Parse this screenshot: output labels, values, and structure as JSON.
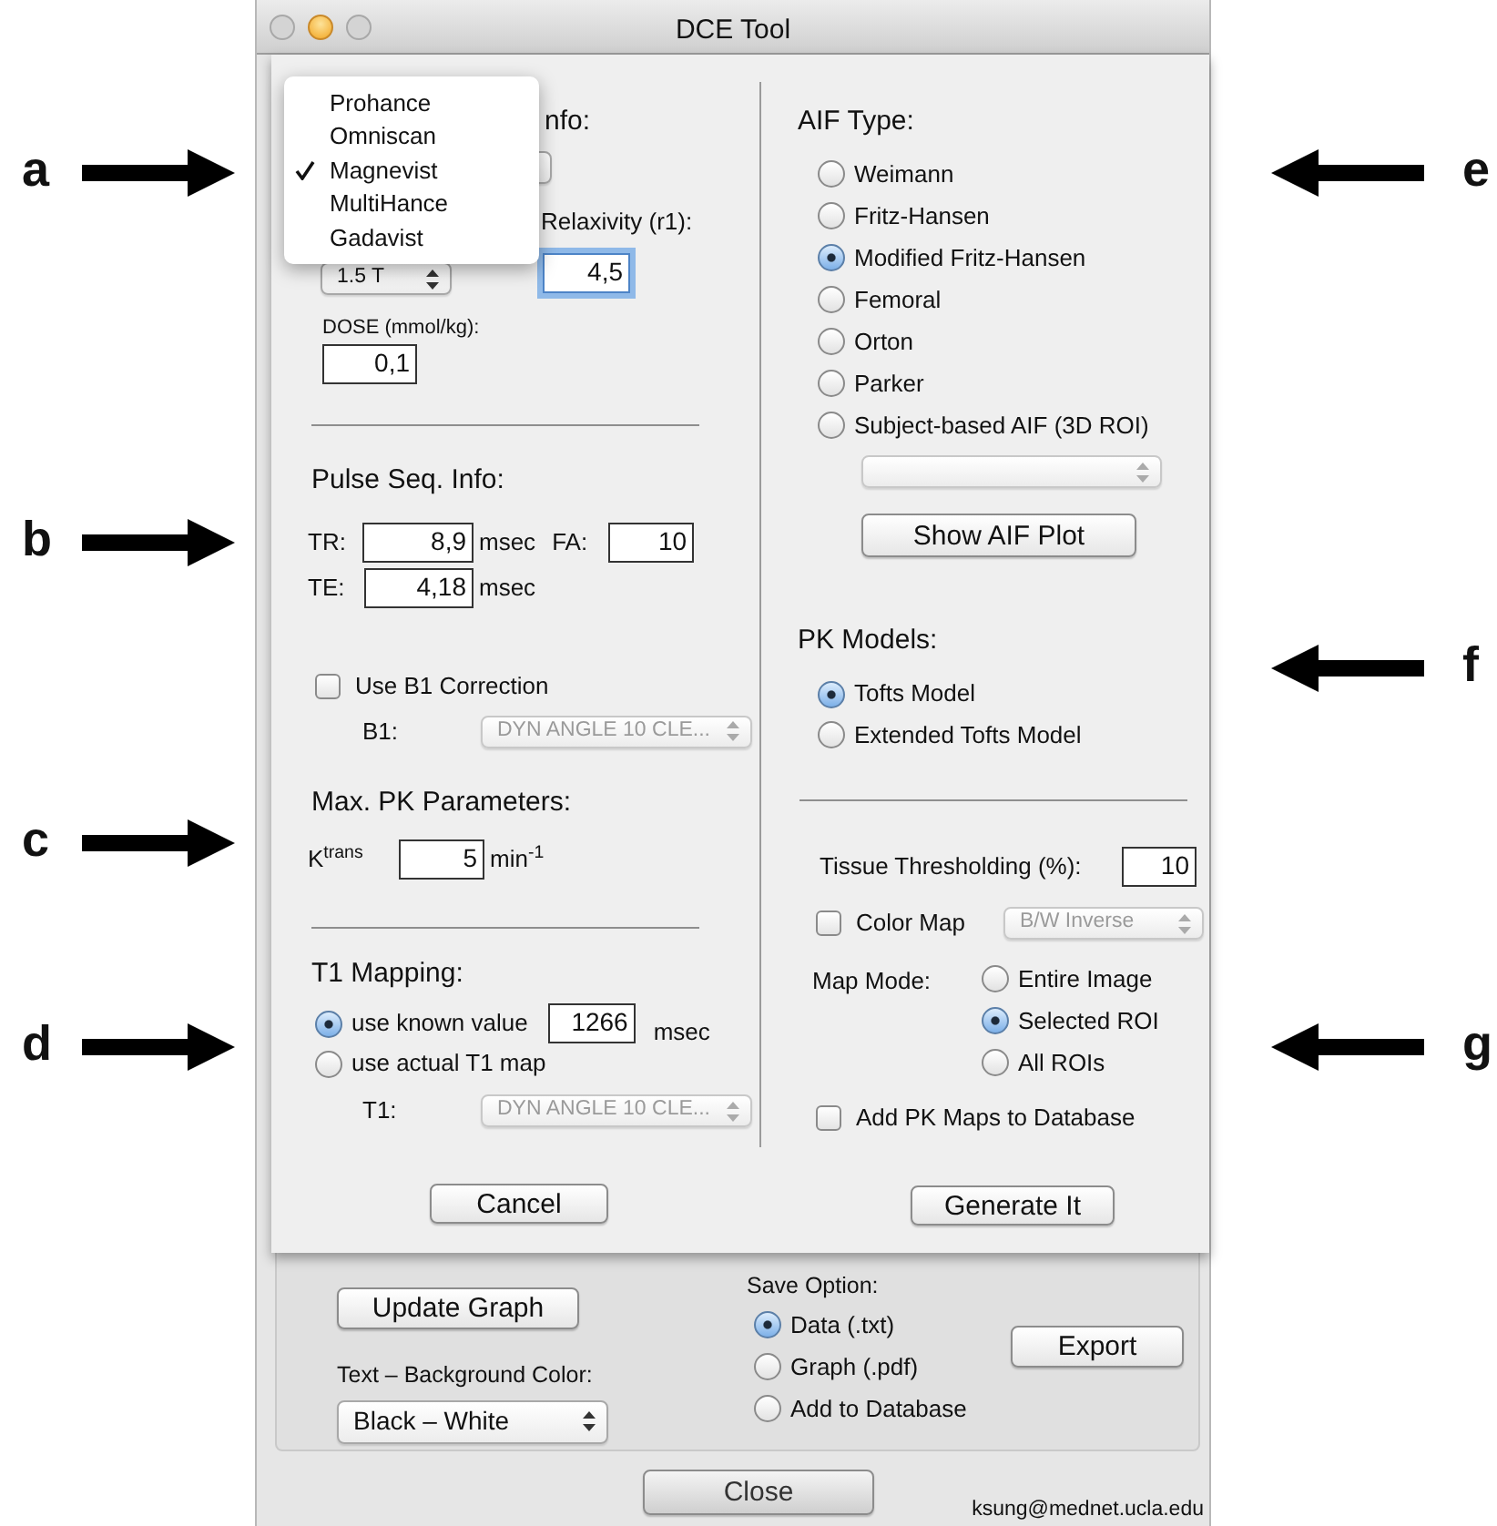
{
  "annotations": {
    "left": [
      "a",
      "b",
      "c",
      "d"
    ],
    "right": [
      "e",
      "f",
      "g"
    ]
  },
  "window": {
    "title": "DCE Tool"
  },
  "agent_menu": {
    "items": [
      {
        "label": "Prohance",
        "selected": false
      },
      {
        "label": "Omniscan",
        "selected": false
      },
      {
        "label": "Magnevist",
        "selected": true
      },
      {
        "label": "MultiHance",
        "selected": false
      },
      {
        "label": "Gadavist",
        "selected": false
      }
    ]
  },
  "contrast_agent": {
    "heading": "nfo:",
    "field_strength": "1.5 T",
    "relaxivity_label": "Relaxivity (r1):",
    "relaxivity": {
      "value": "4,5",
      "focused": true
    },
    "dose_label": "DOSE (mmol/kg):",
    "dose": "0,1"
  },
  "pulse_seq": {
    "heading": "Pulse Seq. Info:",
    "tr_label": "TR:",
    "tr": "8,9",
    "tr_unit": "msec",
    "fa_label": "FA:",
    "fa": "10",
    "te_label": "TE:",
    "te": "4,18",
    "te_unit": "msec",
    "b1_correction": {
      "label": "Use B1 Correction",
      "checked": false
    },
    "b1_label": "B1:",
    "b1_select": {
      "value": "DYN ANGLE 10 CLE...",
      "disabled": true
    }
  },
  "max_pk": {
    "heading": "Max. PK Parameters:",
    "ktrans_label": "K$^{trans}$",
    "ktrans": "5",
    "unit": "min$^{-1}$"
  },
  "t1_mapping": {
    "heading": "T1 Mapping:",
    "options": [
      {
        "label": "use known value",
        "selected": true
      },
      {
        "label": "use actual T1 map",
        "selected": false
      }
    ],
    "known_value": "1266",
    "unit": "msec",
    "t1_label": "T1:",
    "t1_select": {
      "value": "DYN ANGLE 10 CLE...",
      "disabled": true
    }
  },
  "cancel_button": "Cancel",
  "aif_type": {
    "heading": "AIF Type:",
    "options": [
      {
        "label": "Weimann",
        "selected": false
      },
      {
        "label": "Fritz-Hansen",
        "selected": false
      },
      {
        "label": "Modified Fritz-Hansen",
        "selected": true
      },
      {
        "label": "Femoral",
        "selected": false
      },
      {
        "label": "Orton",
        "selected": false
      },
      {
        "label": "Parker",
        "selected": false
      },
      {
        "label": "Subject-based AIF (3D ROI)",
        "selected": false
      }
    ],
    "roi_select": {
      "disabled": true
    },
    "plot_button": "Show AIF Plot"
  },
  "pk_models": {
    "heading": "PK Models:",
    "options": [
      {
        "label": "Tofts Model",
        "selected": true
      },
      {
        "label": "Extended Tofts Model",
        "selected": false
      }
    ]
  },
  "maps": {
    "threshold_label": "Tissue Thresholding (%):",
    "threshold": "10",
    "color_map": {
      "label": "Color Map",
      "checked": false
    },
    "color_map_select": {
      "value": "B/W Inverse",
      "disabled": true
    },
    "map_mode_label": "Map Mode:",
    "map_mode": [
      {
        "label": "Entire Image",
        "selected": false
      },
      {
        "label": "Selected ROI",
        "selected": true
      },
      {
        "label": "All ROIs",
        "selected": false
      }
    ],
    "add_to_database": {
      "label": "Add PK Maps to Database",
      "checked": false
    }
  },
  "generate_button": "Generate It",
  "graph_panel": {
    "update_button": "Update Graph",
    "color_label": "Text – Background Color:",
    "color_select": "Black – White",
    "save_label": "Save Option:",
    "save_options": [
      {
        "label": "Data (.txt)",
        "selected": true
      },
      {
        "label": "Graph (.pdf)",
        "selected": false
      },
      {
        "label": "Add to Database",
        "selected": false
      }
    ],
    "export_button": "Export"
  },
  "close_button": "Close",
  "footer_email": "ksung@mednet.ucla.edu"
}
